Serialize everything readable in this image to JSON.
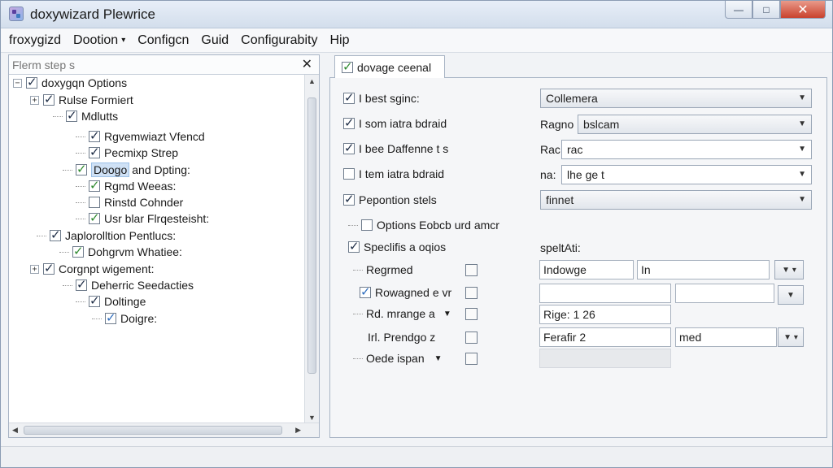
{
  "window": {
    "title": "doxywizard Plewrice"
  },
  "controls": {
    "minimize": "—",
    "maximize": "□",
    "close": "✕"
  },
  "menu": [
    {
      "label": "froxygizd",
      "caret": ""
    },
    {
      "label": "Dootion",
      "caret": "▾"
    },
    {
      "label": "Configcn",
      "caret": ""
    },
    {
      "label": "Guid",
      "caret": ""
    },
    {
      "label": "Configurabity",
      "caret": ""
    },
    {
      "label": "Hip",
      "caret": ""
    }
  ],
  "left": {
    "search_placeholder": "Flerm step s",
    "search_close": "✕",
    "tree": [
      {
        "label": "doxygqn Options"
      },
      {
        "label": "Rulse Formiert"
      },
      {
        "label": "Mdlutts"
      },
      {
        "label": "Rgvemwiazt Vfencd"
      },
      {
        "label": "Pecmixp Strep"
      },
      {
        "label_hl": "Doogo",
        "label": "and Dpting:"
      },
      {
        "label": "Rgmd Weeas:"
      },
      {
        "label": "Rinstd Cohnder"
      },
      {
        "label": "Usr blar Flrqesteisht:"
      },
      {
        "label": "Japlorolltion Pentlucs:"
      },
      {
        "label": "Dohgrvm Whatiee:"
      },
      {
        "label": "Corgnpt wigement:"
      },
      {
        "label": "Deherric Seedacties"
      },
      {
        "label": "Doltinge"
      },
      {
        "label": "Doigre:"
      }
    ]
  },
  "right": {
    "tab_label": "dovage ceenal",
    "rows": [
      {
        "label": "I best sginc:",
        "combo_value": "Collemera"
      },
      {
        "label": "I som iatra bdraid",
        "prefix": "Ragno",
        "combo_value": "bslcam"
      },
      {
        "label": "I bee Daffenne t s",
        "prefix": "Rac",
        "combo_value": "rac"
      },
      {
        "label": "I tem iatra bdraid",
        "prefix": "na:",
        "combo_value": "lhe ge t"
      },
      {
        "label": "Pepontion stels",
        "combo_value": "finnet"
      }
    ],
    "option_label": "Options Eobcb urd amcr",
    "section_label": "Speclifis a oqios",
    "section_right_label": "speltAti:",
    "sub_rows": [
      {
        "label": "Regrmed",
        "field1": "Indowge",
        "field2": "In"
      },
      {
        "label": "Rowagned e vr",
        "field1": "",
        "field2": ""
      },
      {
        "label": "Rd. mrange a",
        "field1": "Rige: 1 26"
      },
      {
        "label": "Irl. Prendgo z",
        "field1": "Ferafir 2",
        "field2": "med"
      },
      {
        "label": "Oede ispan",
        "field1": ""
      }
    ]
  }
}
